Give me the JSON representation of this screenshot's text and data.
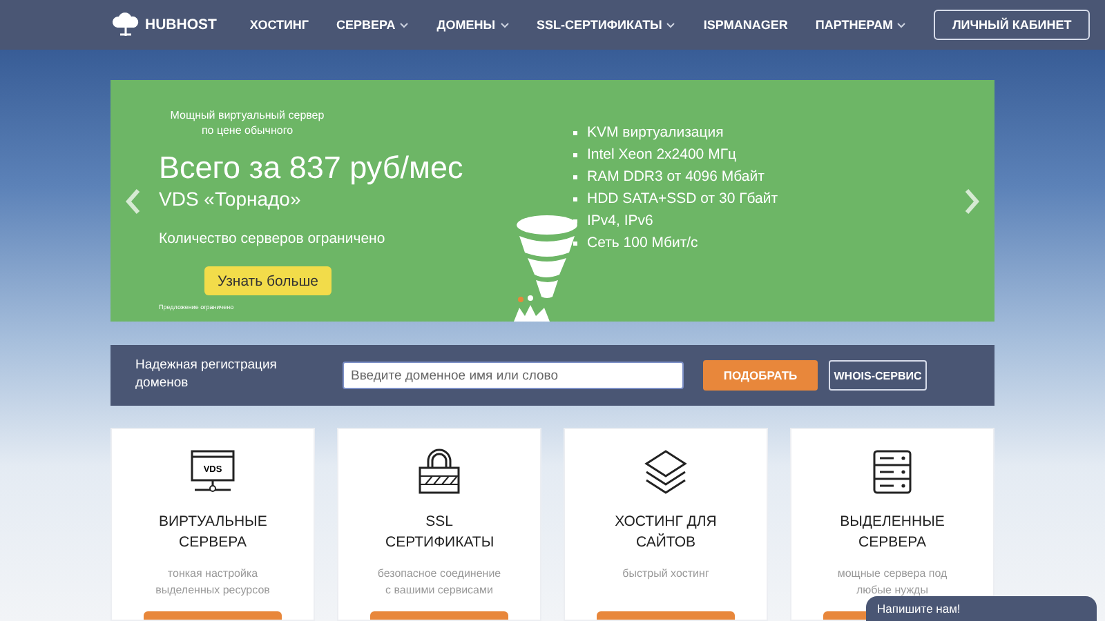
{
  "nav": {
    "logo": "HUBHOST",
    "items": [
      {
        "label": "ХОСТИНГ",
        "dropdown": false
      },
      {
        "label": "СЕРВЕРА",
        "dropdown": true
      },
      {
        "label": "ДОМЕНЫ",
        "dropdown": true
      },
      {
        "label": "SSL-СЕРТИФИКАТЫ",
        "dropdown": true
      },
      {
        "label": "ISPMANAGER",
        "dropdown": false
      },
      {
        "label": "ПАРТНЕРАМ",
        "dropdown": true
      }
    ],
    "account_button": "ЛИЧНЫЙ КАБИНЕТ"
  },
  "banner": {
    "subtitle": "Мощный виртуальный сервер по цене обычного",
    "headline": "Всего за 837 руб/мес",
    "product": "VDS «Торнадо»",
    "note": "Количество серверов ограничено",
    "button": "Узнать больше",
    "fine_print": "Предложение ограничено",
    "features": [
      "KVM виртуализация",
      "Intel Xeon 2x2400 МГц",
      "RAM DDR3 от 4096 Мбайт",
      "HDD SATA+SSD от 30 Гбайт",
      "IPv4, IPv6",
      "Сеть 100 Мбит/с"
    ]
  },
  "domain_search": {
    "label": "Надежная регистрация доменов",
    "placeholder": "Введите доменное имя или слово",
    "search_button": "ПОДОБРАТЬ",
    "whois_button": "WHOIS-СЕРВИС"
  },
  "services": [
    {
      "kind": "vds",
      "icon_text": "VDS",
      "title": "ВИРТУАЛЬНЫЕ СЕРВЕРА",
      "description": "тонкая настройка выделенных ресурсов"
    },
    {
      "kind": "ssl",
      "title": "SSL СЕРТИФИКАТЫ",
      "description": "безопасное соединение с вашими сервисами"
    },
    {
      "kind": "hosting",
      "title": "ХОСТИНГ ДЛЯ САЙТОВ",
      "description": "быстрый хостинг"
    },
    {
      "kind": "dedicated",
      "title": "ВЫДЕЛЕННЫЕ СЕРВЕРА",
      "description": "мощные сервера под любые нужды"
    }
  ],
  "chat": {
    "label": "Напишите нам!"
  }
}
